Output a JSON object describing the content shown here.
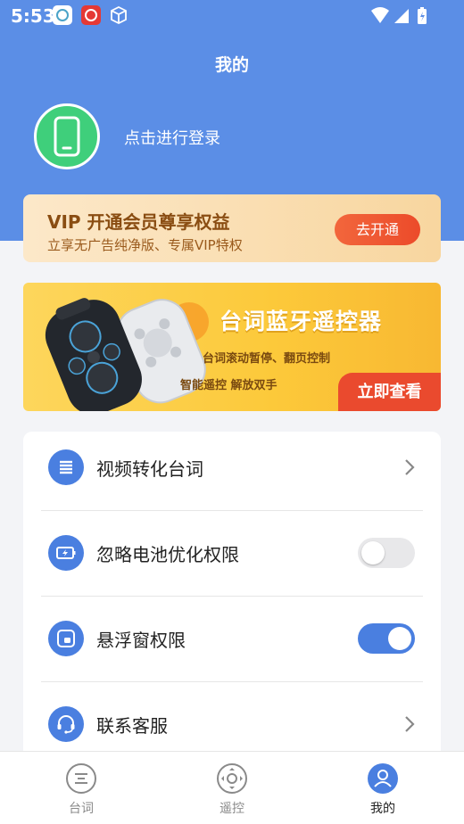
{
  "status_bar": {
    "time": "5:53"
  },
  "header": {
    "title": "我的"
  },
  "profile": {
    "login_text": "点击进行登录"
  },
  "vip": {
    "title": "VIP  开通会员尊享权益",
    "subtitle": "立享无广告纯净版、专属VIP特权",
    "button_label": "去开通"
  },
  "banner": {
    "title": "台词蓝牙遥控器",
    "line1": "台词滚动暂停、翻页控制",
    "line2": "智能遥控  解放双手",
    "button_label": "立即查看"
  },
  "settings": {
    "items": [
      {
        "label": "视频转化台词",
        "icon": "list-icon",
        "control": "arrow"
      },
      {
        "label": "忽略电池优化权限",
        "icon": "battery-icon",
        "control": "toggle",
        "enabled": false
      },
      {
        "label": "悬浮窗权限",
        "icon": "floating-window-icon",
        "control": "toggle",
        "enabled": true
      },
      {
        "label": "联系客服",
        "icon": "headset-icon",
        "control": "arrow"
      }
    ]
  },
  "bottom_nav": {
    "items": [
      {
        "label": "台词",
        "icon": "script-icon",
        "active": false
      },
      {
        "label": "遥控",
        "icon": "remote-icon",
        "active": false
      },
      {
        "label": "我的",
        "icon": "user-icon",
        "active": true
      }
    ]
  },
  "colors": {
    "primary": "#5b8ee6",
    "accent": "#4a7fe0",
    "vip_button": "#ec4b2a",
    "avatar": "#3fcf7b"
  }
}
